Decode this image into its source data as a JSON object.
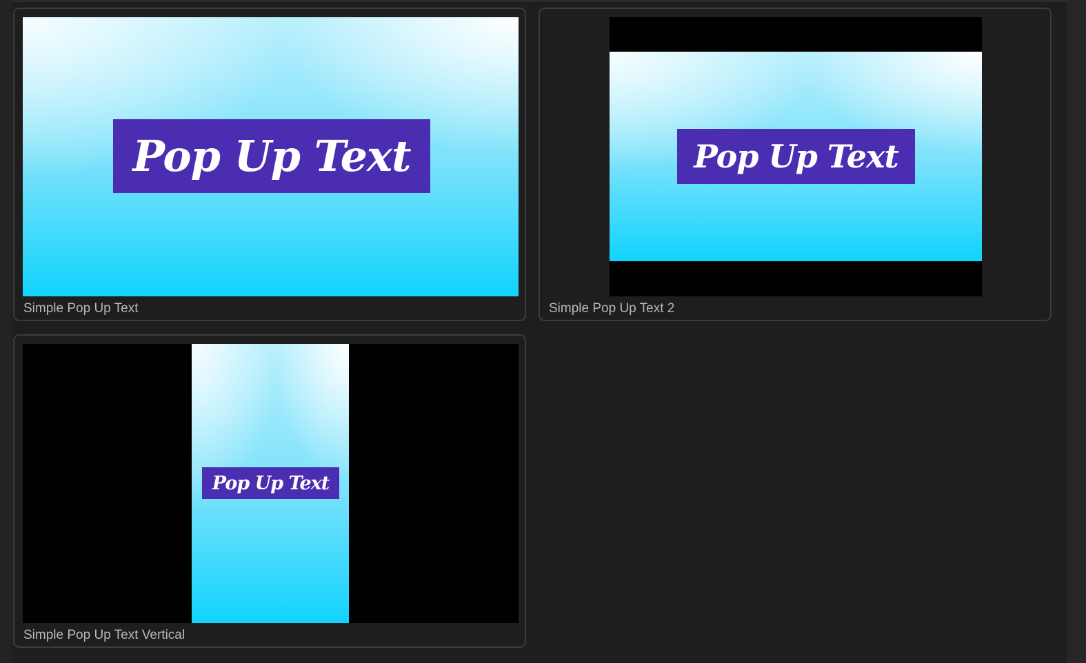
{
  "items": [
    {
      "name": "Simple Pop Up Text",
      "preview_text": "Pop Up Text"
    },
    {
      "name": "Simple Pop Up Text 2",
      "preview_text": "Pop Up Text"
    },
    {
      "name": "Simple Pop Up Text Vertical",
      "preview_text": "Pop Up Text"
    }
  ],
  "colors": {
    "banner": "#4a2db0",
    "background": "#1e1e1e"
  }
}
